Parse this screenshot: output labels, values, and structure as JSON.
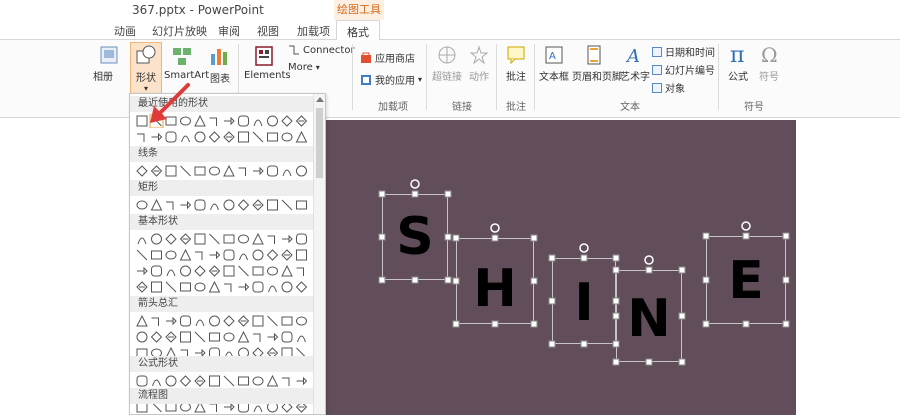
{
  "window": {
    "title": "367.pptx - PowerPoint",
    "context_tool": "绘图工具"
  },
  "tabs": [
    "动画",
    "幻灯片放映",
    "审阅",
    "视图",
    "加载项",
    "格式"
  ],
  "ribbon": {
    "partial_left_label": "相册",
    "illustrations": {
      "shapes": "形状",
      "smartart": "SmartArt",
      "chart": "图表"
    },
    "elements": {
      "label": "Elements",
      "connector": "Connector",
      "more": "More"
    },
    "addins": {
      "store": "应用商店",
      "my_apps": "我的应用",
      "group": "加载项"
    },
    "links": {
      "hyperlink": "超链接",
      "action": "动作",
      "group": "链接"
    },
    "comments": {
      "comment": "批注",
      "group": "批注"
    },
    "text": {
      "textbox": "文本框",
      "header_footer": "页眉和页脚",
      "wordart": "艺术字",
      "date_time": "日期和时间",
      "slide_number": "幻灯片编号",
      "object": "对象",
      "group": "文本"
    },
    "symbols": {
      "equation": "公式",
      "symbol": "符号",
      "group": "符号"
    }
  },
  "shapes_panel": {
    "categories": [
      "最近使用的形状",
      "线条",
      "矩形",
      "基本形状",
      "箭头总汇",
      "公式形状",
      "流程图"
    ]
  },
  "slide": {
    "background": "#614e5a",
    "letters": [
      "S",
      "H",
      "I",
      "N",
      "E"
    ]
  },
  "colors": {
    "accent_orange": "#d66a1b",
    "arrow_red": "#e03b3b",
    "ribbon_blue": "#2e6fb7"
  }
}
